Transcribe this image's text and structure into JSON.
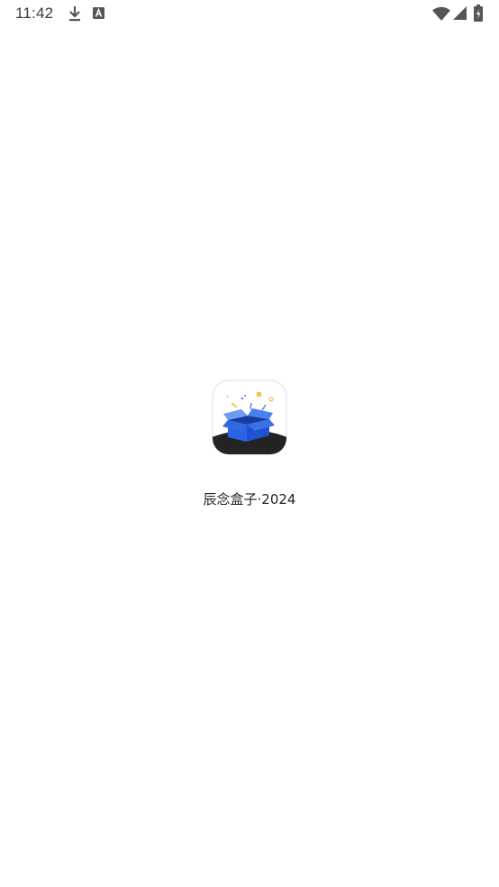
{
  "status_bar": {
    "time": "11:42",
    "icons": [
      "download-icon",
      "a-icon",
      "wifi-icon",
      "signal-icon",
      "battery-icon"
    ]
  },
  "splash": {
    "logo_icon": "gift-box-icon",
    "app_name": "辰念盒子·2024",
    "colors": {
      "box_blue": "#2a63e8",
      "box_light": "#6f9bf2",
      "base_dark": "#222222",
      "confetti_yellow": "#f5c242"
    }
  }
}
